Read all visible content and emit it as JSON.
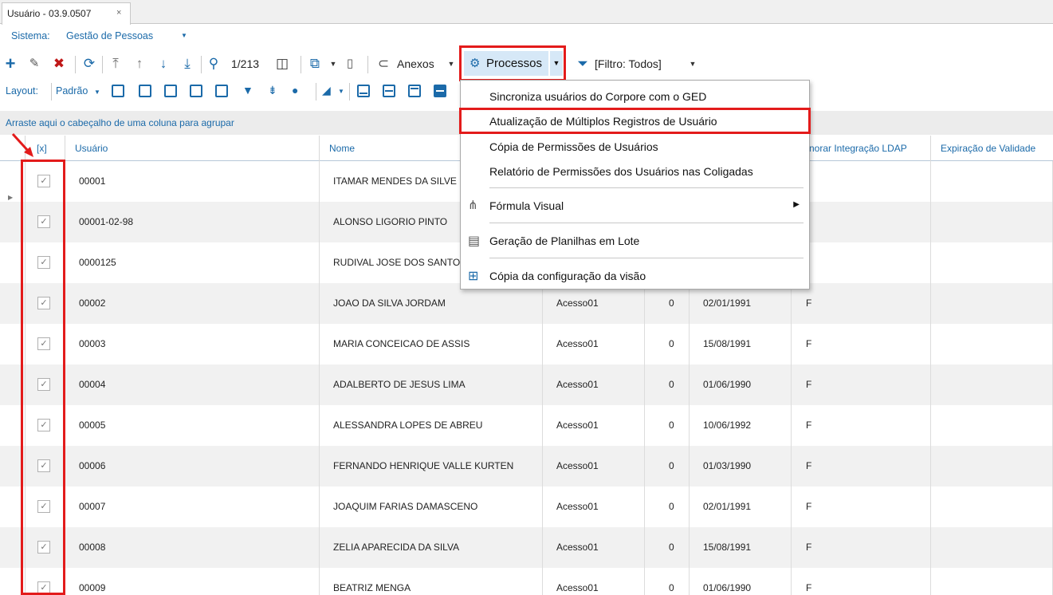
{
  "window": {
    "tab_title": "Usuário - 03.9.0507",
    "close_glyph": "×"
  },
  "system": {
    "label": "Sistema:",
    "value": "Gestão de Pessoas"
  },
  "toolbar": {
    "record_position": "1/213",
    "attachments_label": "Anexos",
    "processes_label": "Processos",
    "filter_label": "[Filtro: Todos]"
  },
  "layout_bar": {
    "label": "Layout:",
    "value": "Padrão"
  },
  "group_hint": "Arraste aqui o cabeçalho de uma coluna para agrupar",
  "grid": {
    "headers": {
      "check": "[x]",
      "usuario": "Usuário",
      "nome": "Nome",
      "ignorar_ldap": "norar Integração LDAP",
      "expiracao": "Expiração de Validade"
    },
    "rows": [
      {
        "usuario": "00001",
        "nome": "ITAMAR MENDES DA SILVE",
        "acesso": "",
        "zero": "",
        "data": "",
        "f": ""
      },
      {
        "usuario": "00001-02-98",
        "nome": "ALONSO LIGORIO PINTO",
        "acesso": "",
        "zero": "",
        "data": "",
        "f": ""
      },
      {
        "usuario": "0000125",
        "nome": "RUDIVAL JOSE DOS SANTO",
        "acesso": "",
        "zero": "",
        "data": "",
        "f": ""
      },
      {
        "usuario": "00002",
        "nome": "JOAO DA SILVA JORDAM",
        "acesso": "Acesso01",
        "zero": "0",
        "data": "02/01/1991",
        "f": "F"
      },
      {
        "usuario": "00003",
        "nome": "MARIA CONCEICAO DE ASSIS",
        "acesso": "Acesso01",
        "zero": "0",
        "data": "15/08/1991",
        "f": "F"
      },
      {
        "usuario": "00004",
        "nome": "ADALBERTO DE JESUS LIMA",
        "acesso": "Acesso01",
        "zero": "0",
        "data": "01/06/1990",
        "f": "F"
      },
      {
        "usuario": "00005",
        "nome": "ALESSANDRA LOPES DE ABREU",
        "acesso": "Acesso01",
        "zero": "0",
        "data": "10/06/1992",
        "f": "F"
      },
      {
        "usuario": "00006",
        "nome": "FERNANDO HENRIQUE VALLE KURTEN",
        "acesso": "Acesso01",
        "zero": "0",
        "data": "01/03/1990",
        "f": "F"
      },
      {
        "usuario": "00007",
        "nome": "JOAQUIM FARIAS DAMASCENO",
        "acesso": "Acesso01",
        "zero": "0",
        "data": "02/01/1991",
        "f": "F"
      },
      {
        "usuario": "00008",
        "nome": "ZELIA APARECIDA DA SILVA",
        "acesso": "Acesso01",
        "zero": "0",
        "data": "15/08/1991",
        "f": "F"
      },
      {
        "usuario": "00009",
        "nome": "BEATRIZ MENGA",
        "acesso": "Acesso01",
        "zero": "0",
        "data": "01/06/1990",
        "f": "F"
      }
    ]
  },
  "menu": {
    "items": [
      {
        "label": "Sincroniza usuários do Corpore com o GED",
        "icon": ""
      },
      {
        "label": "Atualização de Múltiplos Registros de Usuário",
        "icon": ""
      },
      {
        "label": "Cópia de Permissões de Usuários",
        "icon": ""
      },
      {
        "label": "Relatório de Permissões dos Usuários nas Coligadas",
        "icon": ""
      },
      {
        "label": "Fórmula Visual",
        "icon": "org-chart-icon"
      },
      {
        "label": "Geração de Planilhas em Lote",
        "icon": "spreadsheet-icon"
      },
      {
        "label": "Cópia da configuração da visão",
        "icon": "grid-icon"
      }
    ]
  },
  "colors": {
    "accent": "#1b6aa9",
    "highlight_red": "#e31b1b",
    "selected_bg": "#d6e8f7"
  }
}
